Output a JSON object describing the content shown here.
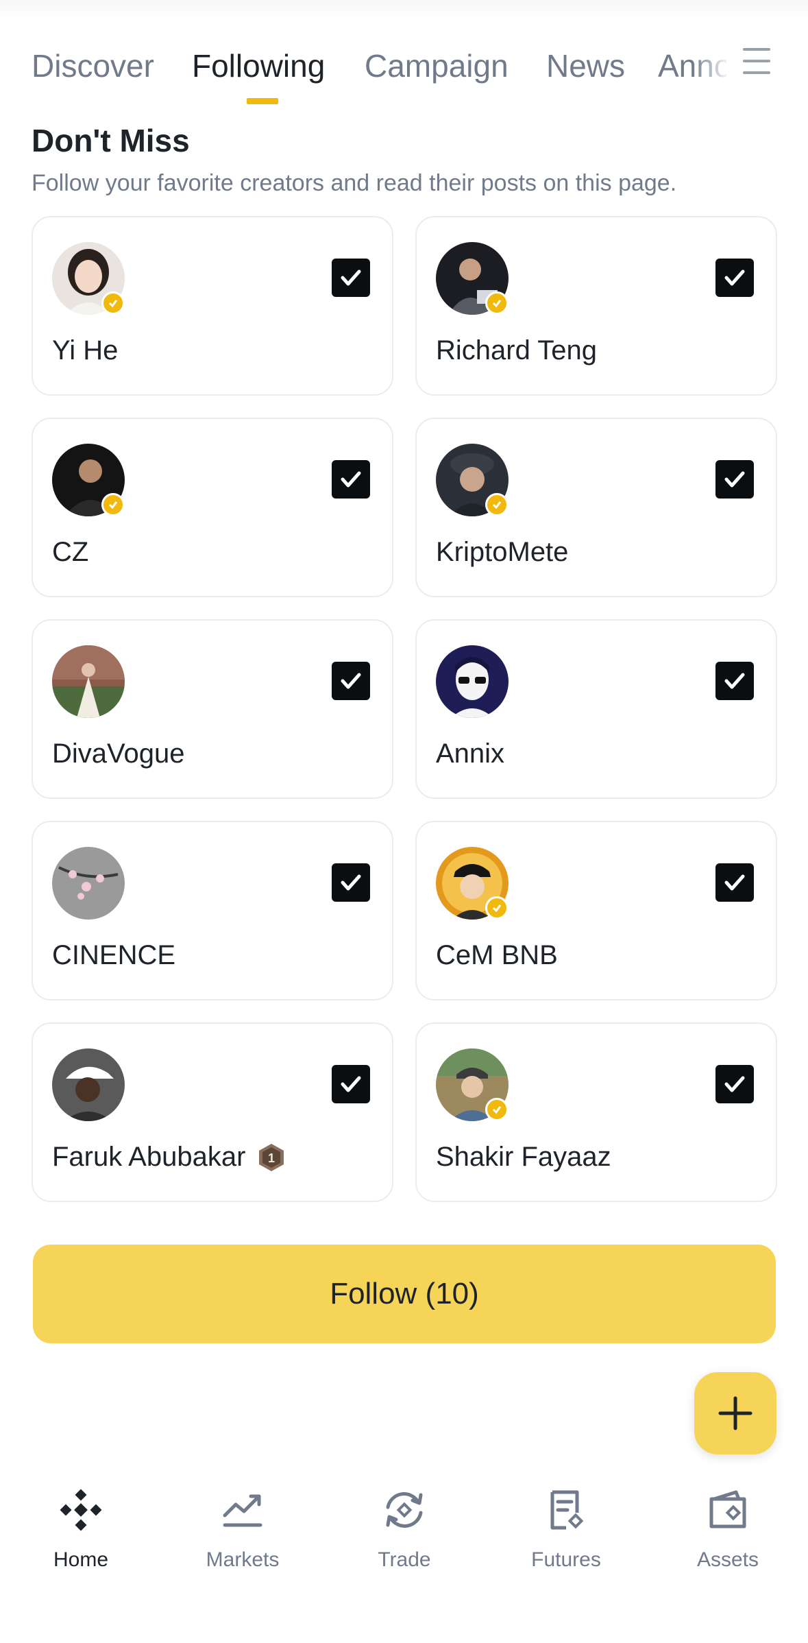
{
  "tabs": [
    {
      "label": "Discover",
      "active": false
    },
    {
      "label": "Following",
      "active": true
    },
    {
      "label": "Campaign",
      "active": false
    },
    {
      "label": "News",
      "active": false
    },
    {
      "label": "Anno",
      "active": false
    }
  ],
  "section": {
    "title": "Don't Miss",
    "subtitle": "Follow your favorite creators and read their posts on this page."
  },
  "creators": [
    {
      "name": "Yi He",
      "verified": true,
      "checked": true,
      "avatar": "photo-woman"
    },
    {
      "name": "Richard Teng",
      "verified": true,
      "checked": true,
      "avatar": "photo-man-suit"
    },
    {
      "name": "CZ",
      "verified": true,
      "checked": true,
      "avatar": "photo-man-dark"
    },
    {
      "name": "KriptoMete",
      "verified": true,
      "checked": true,
      "avatar": "photo-boy-cap"
    },
    {
      "name": "DivaVogue",
      "verified": false,
      "checked": true,
      "avatar": "photo-woman-dress"
    },
    {
      "name": "Annix",
      "verified": false,
      "checked": true,
      "avatar": "illustration-sunglasses"
    },
    {
      "name": "CINENCE",
      "verified": false,
      "checked": true,
      "avatar": "photo-blossom"
    },
    {
      "name": "CeM BNB",
      "verified": true,
      "checked": true,
      "avatar": "illustration-cap"
    },
    {
      "name": "Faruk Abubakar",
      "verified": false,
      "checked": true,
      "avatar": "photo-man-white-cap",
      "rank_badge": "1"
    },
    {
      "name": "Shakir Fayaaz",
      "verified": true,
      "checked": true,
      "avatar": "illustration-hoodie"
    }
  ],
  "follow_button": {
    "label": "Follow (10)"
  },
  "fab": {
    "icon": "plus-icon"
  },
  "bottom_nav": [
    {
      "label": "Home",
      "icon": "binance-logo-icon",
      "active": true
    },
    {
      "label": "Markets",
      "icon": "chart-trend-icon",
      "active": false
    },
    {
      "label": "Trade",
      "icon": "trade-swap-icon",
      "active": false
    },
    {
      "label": "Futures",
      "icon": "futures-document-icon",
      "active": false
    },
    {
      "label": "Assets",
      "icon": "wallet-icon",
      "active": false
    }
  ],
  "colors": {
    "accent": "#f0b90b",
    "button": "#f5d457",
    "text_primary": "#1e2329",
    "text_secondary": "#707a8a",
    "card_border": "#eaecef",
    "checkbox": "#0b0e11"
  }
}
